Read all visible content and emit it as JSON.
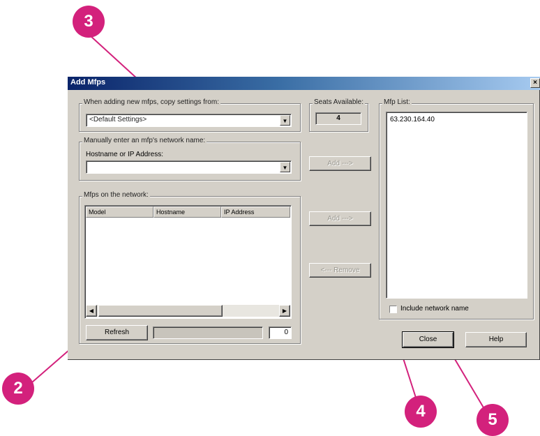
{
  "window": {
    "title": "Add Mfps",
    "close_glyph": "×"
  },
  "copy_settings": {
    "label": "When adding new mfps, copy settings from:",
    "value": "<Default Settings>"
  },
  "seats": {
    "label": "Seats Available:",
    "value": "4"
  },
  "mfp_list": {
    "label": "Mfp List:",
    "items": [
      "63.230.164.40"
    ]
  },
  "manual_entry": {
    "label": "Manually enter an mfp's network name:",
    "field_label": "Hostname or IP Address:",
    "value": ""
  },
  "add_button_1": "Add --->",
  "network": {
    "label": "Mfps on the network:",
    "columns": [
      "Model",
      "Hostname",
      "IP Address"
    ],
    "rows": []
  },
  "add_button_2": "Add --->",
  "remove_button": "<--- Remove",
  "include_checkbox": {
    "label": "Include network name",
    "checked": false
  },
  "refresh_button": "Refresh",
  "progress_count": "0",
  "close_button": "Close",
  "help_button": "Help",
  "callouts": {
    "c2": "2",
    "c3": "3",
    "c4": "4",
    "c5": "5"
  },
  "colors": {
    "callout": "#d3217c",
    "titlebar": "#0a246a",
    "dialog": "#d4d0c8"
  }
}
